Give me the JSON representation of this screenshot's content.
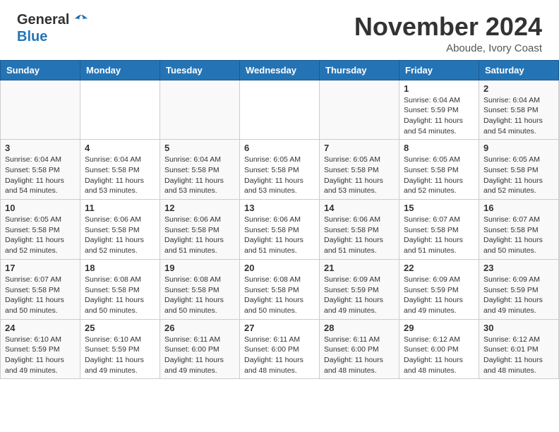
{
  "header": {
    "logo_general": "General",
    "logo_blue": "Blue",
    "month_title": "November 2024",
    "location": "Aboude, Ivory Coast"
  },
  "days_of_week": [
    "Sunday",
    "Monday",
    "Tuesday",
    "Wednesday",
    "Thursday",
    "Friday",
    "Saturday"
  ],
  "weeks": [
    [
      {
        "day": "",
        "info": ""
      },
      {
        "day": "",
        "info": ""
      },
      {
        "day": "",
        "info": ""
      },
      {
        "day": "",
        "info": ""
      },
      {
        "day": "",
        "info": ""
      },
      {
        "day": "1",
        "info": "Sunrise: 6:04 AM\nSunset: 5:59 PM\nDaylight: 11 hours and 54 minutes."
      },
      {
        "day": "2",
        "info": "Sunrise: 6:04 AM\nSunset: 5:58 PM\nDaylight: 11 hours and 54 minutes."
      }
    ],
    [
      {
        "day": "3",
        "info": "Sunrise: 6:04 AM\nSunset: 5:58 PM\nDaylight: 11 hours and 54 minutes."
      },
      {
        "day": "4",
        "info": "Sunrise: 6:04 AM\nSunset: 5:58 PM\nDaylight: 11 hours and 53 minutes."
      },
      {
        "day": "5",
        "info": "Sunrise: 6:04 AM\nSunset: 5:58 PM\nDaylight: 11 hours and 53 minutes."
      },
      {
        "day": "6",
        "info": "Sunrise: 6:05 AM\nSunset: 5:58 PM\nDaylight: 11 hours and 53 minutes."
      },
      {
        "day": "7",
        "info": "Sunrise: 6:05 AM\nSunset: 5:58 PM\nDaylight: 11 hours and 53 minutes."
      },
      {
        "day": "8",
        "info": "Sunrise: 6:05 AM\nSunset: 5:58 PM\nDaylight: 11 hours and 52 minutes."
      },
      {
        "day": "9",
        "info": "Sunrise: 6:05 AM\nSunset: 5:58 PM\nDaylight: 11 hours and 52 minutes."
      }
    ],
    [
      {
        "day": "10",
        "info": "Sunrise: 6:05 AM\nSunset: 5:58 PM\nDaylight: 11 hours and 52 minutes."
      },
      {
        "day": "11",
        "info": "Sunrise: 6:06 AM\nSunset: 5:58 PM\nDaylight: 11 hours and 52 minutes."
      },
      {
        "day": "12",
        "info": "Sunrise: 6:06 AM\nSunset: 5:58 PM\nDaylight: 11 hours and 51 minutes."
      },
      {
        "day": "13",
        "info": "Sunrise: 6:06 AM\nSunset: 5:58 PM\nDaylight: 11 hours and 51 minutes."
      },
      {
        "day": "14",
        "info": "Sunrise: 6:06 AM\nSunset: 5:58 PM\nDaylight: 11 hours and 51 minutes."
      },
      {
        "day": "15",
        "info": "Sunrise: 6:07 AM\nSunset: 5:58 PM\nDaylight: 11 hours and 51 minutes."
      },
      {
        "day": "16",
        "info": "Sunrise: 6:07 AM\nSunset: 5:58 PM\nDaylight: 11 hours and 50 minutes."
      }
    ],
    [
      {
        "day": "17",
        "info": "Sunrise: 6:07 AM\nSunset: 5:58 PM\nDaylight: 11 hours and 50 minutes."
      },
      {
        "day": "18",
        "info": "Sunrise: 6:08 AM\nSunset: 5:58 PM\nDaylight: 11 hours and 50 minutes."
      },
      {
        "day": "19",
        "info": "Sunrise: 6:08 AM\nSunset: 5:58 PM\nDaylight: 11 hours and 50 minutes."
      },
      {
        "day": "20",
        "info": "Sunrise: 6:08 AM\nSunset: 5:58 PM\nDaylight: 11 hours and 50 minutes."
      },
      {
        "day": "21",
        "info": "Sunrise: 6:09 AM\nSunset: 5:59 PM\nDaylight: 11 hours and 49 minutes."
      },
      {
        "day": "22",
        "info": "Sunrise: 6:09 AM\nSunset: 5:59 PM\nDaylight: 11 hours and 49 minutes."
      },
      {
        "day": "23",
        "info": "Sunrise: 6:09 AM\nSunset: 5:59 PM\nDaylight: 11 hours and 49 minutes."
      }
    ],
    [
      {
        "day": "24",
        "info": "Sunrise: 6:10 AM\nSunset: 5:59 PM\nDaylight: 11 hours and 49 minutes."
      },
      {
        "day": "25",
        "info": "Sunrise: 6:10 AM\nSunset: 5:59 PM\nDaylight: 11 hours and 49 minutes."
      },
      {
        "day": "26",
        "info": "Sunrise: 6:11 AM\nSunset: 6:00 PM\nDaylight: 11 hours and 49 minutes."
      },
      {
        "day": "27",
        "info": "Sunrise: 6:11 AM\nSunset: 6:00 PM\nDaylight: 11 hours and 48 minutes."
      },
      {
        "day": "28",
        "info": "Sunrise: 6:11 AM\nSunset: 6:00 PM\nDaylight: 11 hours and 48 minutes."
      },
      {
        "day": "29",
        "info": "Sunrise: 6:12 AM\nSunset: 6:00 PM\nDaylight: 11 hours and 48 minutes."
      },
      {
        "day": "30",
        "info": "Sunrise: 6:12 AM\nSunset: 6:01 PM\nDaylight: 11 hours and 48 minutes."
      }
    ]
  ]
}
